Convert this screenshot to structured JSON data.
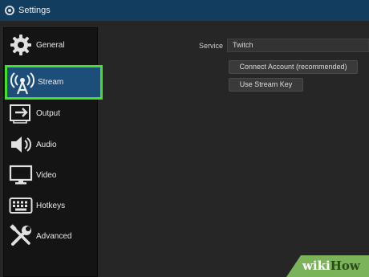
{
  "window": {
    "title": "Settings",
    "app_icon": "obs-logo-icon",
    "titlebar_color": "#123d5e"
  },
  "sidebar": {
    "items": [
      {
        "label": "General",
        "icon": "gear-icon"
      },
      {
        "label": "Stream",
        "icon": "broadcast-antenna-icon",
        "selected": true
      },
      {
        "label": "Output",
        "icon": "output-icon"
      },
      {
        "label": "Audio",
        "icon": "speaker-icon"
      },
      {
        "label": "Video",
        "icon": "monitor-icon"
      },
      {
        "label": "Hotkeys",
        "icon": "keyboard-icon"
      },
      {
        "label": "Advanced",
        "icon": "tools-icon"
      }
    ],
    "highlight_color": "#44e02a",
    "selected_bg": "#1d4e7a"
  },
  "stream": {
    "service_label": "Service",
    "service_value": "Twitch",
    "connect_button": "Connect Account (recommended)",
    "stream_key_button": "Use Stream Key"
  },
  "watermark": {
    "wiki": "wiki",
    "how": "How",
    "color": "#7bb35a"
  }
}
